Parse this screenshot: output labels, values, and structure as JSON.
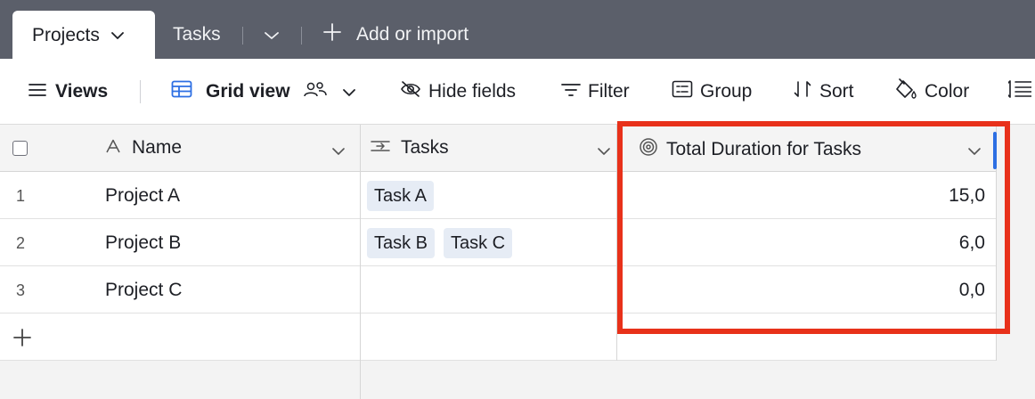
{
  "tabs": {
    "active": {
      "label": "Projects",
      "icon": "chevron-down-icon"
    },
    "inactive": {
      "label": "Tasks"
    },
    "more_icon": "chevron-down-icon",
    "add": {
      "label": "Add or import",
      "icon": "plus-icon"
    }
  },
  "toolbar": {
    "views": {
      "label": "Views",
      "icon": "menu-icon"
    },
    "grid_view": {
      "label": "Grid view",
      "icon": "grid-icon",
      "collab_icon": "users-icon",
      "chevron": "chevron-down-icon"
    },
    "hide_fields": {
      "label": "Hide fields",
      "icon": "eye-off-icon"
    },
    "filter": {
      "label": "Filter",
      "icon": "filter-icon"
    },
    "group": {
      "label": "Group",
      "icon": "group-icon"
    },
    "sort": {
      "label": "Sort",
      "icon": "sort-icon"
    },
    "color": {
      "label": "Color",
      "icon": "paint-bucket-icon"
    },
    "row_height_icon": "row-height-icon"
  },
  "table": {
    "columns": [
      {
        "name": "Name",
        "icon": "text-field-icon"
      },
      {
        "name": "Tasks",
        "icon": "linked-record-icon"
      },
      {
        "name": "Total Duration for Tasks",
        "icon": "rollup-icon"
      }
    ],
    "rows": [
      {
        "num": "1",
        "name": "Project A",
        "tasks": [
          "Task A"
        ],
        "total": "15,0"
      },
      {
        "num": "2",
        "name": "Project B",
        "tasks": [
          "Task B",
          "Task C"
        ],
        "total": "6,0"
      },
      {
        "num": "3",
        "name": "Project C",
        "tasks": [],
        "total": "0,0"
      }
    ],
    "add_row_icon": "plus-icon"
  },
  "colors": {
    "tabbar": "#5b5f6a",
    "highlight": "#e8311a",
    "accent": "#2d6fe3",
    "pill": "#e6ecf5"
  }
}
